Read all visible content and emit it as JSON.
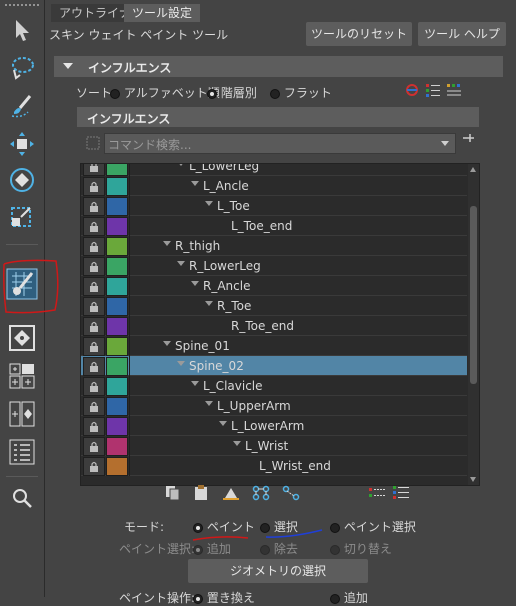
{
  "tabs": [
    {
      "label": "アウトライナ",
      "active": false
    },
    {
      "label": "ツール設定",
      "active": true
    }
  ],
  "tool_title": "スキン ウェイト ペイント ツール",
  "buttons": {
    "reset": "ツールのリセット",
    "help": "ツール ヘルプ"
  },
  "influence_section": "インフルエンス",
  "sort": {
    "label": "ソート:",
    "options": [
      "アルファベット順",
      "階層別",
      "フラット"
    ],
    "selected": "階層別"
  },
  "influence_header": "インフルエンス",
  "search": {
    "placeholder": "コマンド検索..."
  },
  "joints": [
    {
      "name": "L_LowerLeg",
      "color": "#3aa564",
      "selected": false
    },
    {
      "name": "L_Ancle",
      "color": "#2fa59a",
      "selected": false
    },
    {
      "name": "L_Toe",
      "color": "#2f66a6",
      "selected": false
    },
    {
      "name": "L_Toe_end",
      "color": "#6e35a9",
      "selected": false
    },
    {
      "name": "R_thigh",
      "color": "#6aa83a",
      "selected": false
    },
    {
      "name": "R_LowerLeg",
      "color": "#3aa564",
      "selected": false
    },
    {
      "name": "R_Ancle",
      "color": "#2fa59a",
      "selected": false
    },
    {
      "name": "R_Toe",
      "color": "#2f66a6",
      "selected": false
    },
    {
      "name": "R_Toe_end",
      "color": "#6e35a9",
      "selected": false
    },
    {
      "name": "Spine_01",
      "color": "#6aa83a",
      "selected": false
    },
    {
      "name": "Spine_02",
      "color": "#3aa564",
      "selected": true
    },
    {
      "name": "L_Clavicle",
      "color": "#2fa59a",
      "selected": false
    },
    {
      "name": "L_UpperArm",
      "color": "#2f66a6",
      "selected": false
    },
    {
      "name": "L_LowerArm",
      "color": "#6e35a9",
      "selected": false
    },
    {
      "name": "L_Wrist",
      "color": "#b0336e",
      "selected": false
    },
    {
      "name": "L_Wrist_end",
      "color": "#b46f2e",
      "selected": false
    }
  ],
  "mode": {
    "label": "モード:",
    "options": [
      "ペイント",
      "選択",
      "ペイント選択"
    ],
    "selected": "ペイント"
  },
  "paint_select": {
    "label": "ペイント選択:",
    "options": [
      "追加",
      "除去",
      "切り替え"
    ],
    "selected": "追加"
  },
  "geometry_button": "ジオメトリの選択",
  "paint_operation": {
    "label": "ペイント操作:",
    "options": [
      "置き換え",
      "追加"
    ]
  },
  "annotation_colors": {
    "red": "#d01818",
    "blue": "#1f3fd8"
  }
}
